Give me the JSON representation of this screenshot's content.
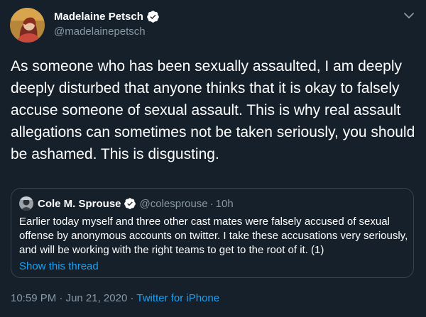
{
  "author": {
    "display_name": "Madelaine Petsch",
    "handle": "@madelainepetsch"
  },
  "tweet": {
    "text": "As someone who has been sexually assaulted, I am deeply deeply disturbed that anyone thinks that it is okay to falsely accuse someone of sexual assault. This is why real assault allegations can sometimes not be taken seriously, you should be ashamed. This is disgusting."
  },
  "quoted": {
    "display_name": "Cole M. Sprouse",
    "handle": "@colesprouse",
    "separator": "·",
    "time": "10h",
    "text": "Earlier today myself and three other cast mates were falsely accused of sexual offense by anonymous accounts on twitter. I take these accusations very seriously, and will be working with the right teams to get to the root of it. (1)",
    "thread_link": "Show this thread"
  },
  "meta": {
    "time": "10:59 PM",
    "separator": " · ",
    "date": "Jun 21, 2020",
    "source": "Twitter for iPhone"
  },
  "icons": {
    "verified": "verified-badge-icon",
    "caret": "chevron-down-icon"
  },
  "colors": {
    "background": "#15202b",
    "accent": "#1da1f2",
    "muted": "#8899a6",
    "border": "#38444d"
  }
}
